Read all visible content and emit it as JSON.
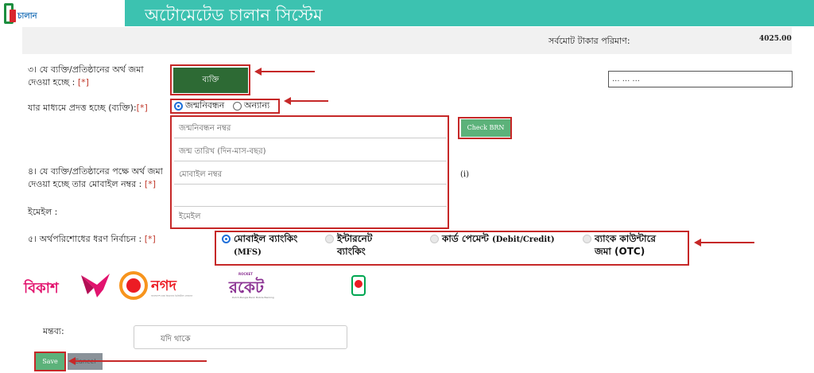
{
  "header": {
    "title": "অটোমেটেড চালান সিস্টেম",
    "logo_text": "চালান"
  },
  "summary": {
    "label": "সর্বমোট টাকার পরিমাণ:",
    "value": "4025.00"
  },
  "depositor": {
    "label": "৩। যে ব্যক্তি/প্রতিষ্ঠানের অর্থ জমা দেওয়া হচ্ছে :",
    "required_mark": "[*]",
    "type_button": "ব্যক্তি",
    "input_value": "... ... ..."
  },
  "via": {
    "label": "যার মাধ্যমে প্রদত্ত হচ্ছে (ব্যক্তি):",
    "required_mark": "[*]",
    "options": [
      "জন্মনিবন্ধন",
      "অন্যান্য"
    ],
    "selected": "জন্মনিবন্ধন"
  },
  "fields": {
    "brn_placeholder": "জন্মনিবন্ধন নম্বর",
    "dob_placeholder": "জন্ম তারিখ (দিন-মাস-বছর)",
    "mobile_placeholder": "মোবাইল নম্বর",
    "email_placeholder": "ইমেইল",
    "check_brn_button": "Check BRN",
    "info_marker": "(i)"
  },
  "mobile_section": {
    "label": "৪। যে ব্যক্তি/প্রতিষ্ঠানের পক্ষে অর্থ জমা দেওয়া হচ্ছে তার মোবাইল নম্বর :",
    "required_mark": "[*]",
    "email_label": "ইমেইল :"
  },
  "payment": {
    "label": "৫। অর্থপরিশোধের ধরণ নির্বাচন :",
    "required_mark": "[*]",
    "options": [
      {
        "line1": "মোবাইল ব্যাংকিং",
        "line2": "(MFS)"
      },
      {
        "line1": "ইন্টারনেট",
        "line2": "ব্যাংকিং"
      },
      {
        "line1": "কার্ড পেমেন্ট",
        "line2": "(Debit/Credit)"
      },
      {
        "line1": "ব্যাংক কাউন্টারে",
        "line2": "জমা (OTC)"
      }
    ],
    "selected_index": 0
  },
  "providers": {
    "bkash": "বিকাশ",
    "nagad": "নগদ",
    "rocket_top": "ROCKET",
    "rocket": "রকেট",
    "rocket_sub": "Dutch-Bangla Bank Mobile Banking",
    "nagad_sub": "বাংলাদেশ ডাক বিভাগের ডিজিটাল লেনদেন",
    "upay": "upay"
  },
  "comment": {
    "label": "মন্তব্য:",
    "placeholder": "যদি থাকে"
  },
  "actions": {
    "save": "Save",
    "cancel": "Cancel"
  },
  "colors": {
    "header": "#3cc2b0",
    "person_button": "#2d6a34",
    "action_button": "#5cb27a",
    "highlight": "#c62828",
    "bkash": "#e2136e",
    "nagad": "#ec1c24",
    "rocket": "#8c3494"
  }
}
